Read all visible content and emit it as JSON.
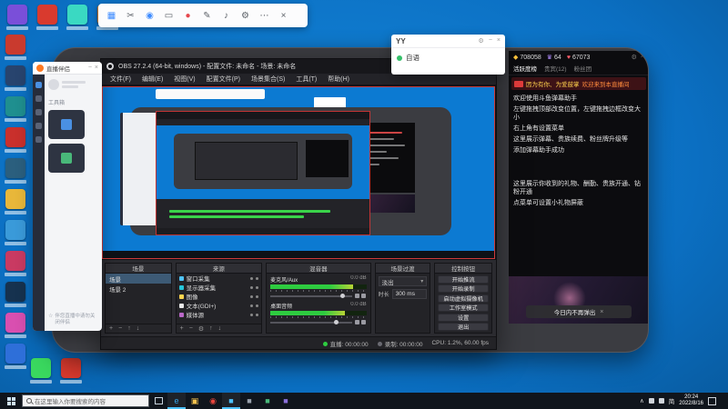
{
  "toolbar": {
    "icons": [
      {
        "name": "apps-icon",
        "glyph": "▦",
        "color": "#3f8cff"
      },
      {
        "name": "screenshot-icon",
        "glyph": "✂",
        "color": "#5a5f66"
      },
      {
        "name": "camera-icon",
        "glyph": "◉",
        "color": "#3f8cff"
      },
      {
        "name": "display-capture-icon",
        "glyph": "▭",
        "color": "#5a5f66"
      },
      {
        "name": "record-icon",
        "glyph": "●",
        "color": "#e5484d"
      },
      {
        "name": "draw-icon",
        "glyph": "✎",
        "color": "#5a5f66"
      },
      {
        "name": "sound-icon",
        "glyph": "♪",
        "color": "#5a5f66"
      },
      {
        "name": "settings-icon",
        "glyph": "⚙",
        "color": "#5a5f66"
      },
      {
        "name": "more-icon",
        "glyph": "⋯",
        "color": "#5a5f66"
      },
      {
        "name": "close-icon",
        "glyph": "×",
        "color": "#5a5f66"
      }
    ]
  },
  "live_assistant": {
    "title": "直播伴侣",
    "window_buttons": [
      "−",
      "×"
    ],
    "section_tools": "工具箱",
    "footer_note": "伴您直播中请勿关闭伴侣",
    "star": "☆"
  },
  "yy": {
    "title": "YY",
    "titlebar_icons": [
      "⚙",
      "−",
      "×"
    ],
    "item": "自语"
  },
  "obs": {
    "title": "OBS 27.2.4 (64-bit, windows) - 配置文件: 未命名 - 场景: 未命名",
    "win_buttons": [
      "−",
      "□",
      "×"
    ],
    "menu": [
      "文件(F)",
      "编辑(E)",
      "视图(V)",
      "配置文件(P)",
      "场景集合(S)",
      "工具(T)",
      "帮助(H)"
    ],
    "scenes": {
      "title": "场景",
      "items": [
        {
          "label": "场景",
          "selected": true
        },
        {
          "label": "场景 2",
          "selected": false
        }
      ],
      "tools": [
        "+",
        "−",
        "↑",
        "↓"
      ]
    },
    "sources": {
      "title": "来源",
      "items": [
        {
          "label": "窗口采集",
          "color": "#4fc3f7"
        },
        {
          "label": "显示器采集",
          "color": "#26c6da"
        },
        {
          "label": "图像",
          "color": "#ffd54f"
        },
        {
          "label": "文本(GDI+)",
          "color": "#e8e8e8"
        },
        {
          "label": "媒体源",
          "color": "#ba68c8"
        }
      ],
      "tools": [
        "+",
        "−",
        "⚙",
        "↑",
        "↓"
      ]
    },
    "mixer": {
      "title": "混音器",
      "channels": [
        {
          "name": "麦克风/Aux",
          "db": "0.0 dB",
          "level": 0.86
        },
        {
          "name": "桌面音频",
          "db": "0.0 dB",
          "level": 0.78
        }
      ]
    },
    "transitions": {
      "title": "场景过渡",
      "value": "淡出",
      "chevron": "▾",
      "duration_label": "时长",
      "duration": "300 ms"
    },
    "controls": {
      "title": "控制按钮",
      "buttons": [
        "开始推流",
        "开始录制",
        "启动虚拟摄像机",
        "工作室模式",
        "设置",
        "退出"
      ]
    },
    "status": {
      "live": "直播: 00:00:00",
      "rec": "录制: 00:00:00",
      "cpu": "CPU: 1.2%, 60.00 fps"
    }
  },
  "danmaku": {
    "stats": [
      {
        "icon": "diamond-icon",
        "glyph": "◆",
        "color": "#ffc53d",
        "value": "708058"
      },
      {
        "icon": "crown-icon",
        "glyph": "♛",
        "color": "#b08cff",
        "value": "64"
      },
      {
        "icon": "heart-icon",
        "glyph": "♥",
        "color": "#ff5f6b",
        "value": "67073"
      }
    ],
    "header_icons": [
      "⚙",
      "×"
    ],
    "tabs": [
      {
        "label": "活跃度榜",
        "active": true
      },
      {
        "label": "贵宾(12)",
        "active": false
      },
      {
        "label": "粉丝团",
        "active": false
      }
    ],
    "welcome": {
      "user": "因为有你、为爱鼓掌",
      "text": "欢迎来到本直播间"
    },
    "messages": [
      "欢迎使用斗鱼弹幕助手",
      "左键拖拽顶部改变位置，左键拖拽边框改变大小",
      "右上角有设置菜单",
      "这里展示弹幕、贵族续费、粉丝牌升级等",
      "添加弹幕助手成功"
    ],
    "messages2": [
      "这里展示你收到的礼物、酬勤、贵族开通、钻粉开通",
      "点菜单可设置小礼物屏蔽"
    ],
    "toast": "今日内不再弹出",
    "toast_close": "×"
  },
  "taskbar": {
    "search_placeholder": "在这里输入你要搜索的内容",
    "apps": [
      {
        "name": "browser",
        "glyph": "e",
        "color": "#35a3e8",
        "active": true
      },
      {
        "name": "explorer",
        "glyph": "▣",
        "color": "#f2c14e",
        "active": false
      },
      {
        "name": "chrome",
        "glyph": "◉",
        "color": "#e8453c",
        "active": false
      },
      {
        "name": "app-blue",
        "glyph": "■",
        "color": "#4cc2ff",
        "active": true
      },
      {
        "name": "app-gray",
        "glyph": "■",
        "color": "#9aa2ad",
        "active": false
      },
      {
        "name": "app-green",
        "glyph": "■",
        "color": "#49b87a",
        "active": false
      },
      {
        "name": "app-purple",
        "glyph": "■",
        "color": "#8a6fd9",
        "active": false
      }
    ],
    "tray_chevron": "∧",
    "lang": "简",
    "time": "20:24",
    "date": "2022/8/16"
  },
  "desktop": {
    "top_icons": [
      "#7a4fd9",
      "#d93a2e",
      "#3ad9c2",
      "#d9812e"
    ],
    "left_icons": [
      "#c93a2e",
      "#28446e",
      "#1f8f8f",
      "#c9302c",
      "#2b5f7e",
      "#e8b73a",
      "#3a9ad9",
      "#c93a62",
      "#16324f",
      "#d94fb0",
      "#2e6fd9"
    ],
    "bottom_icons": [
      "#3ad95f",
      "#d93a2e"
    ]
  }
}
